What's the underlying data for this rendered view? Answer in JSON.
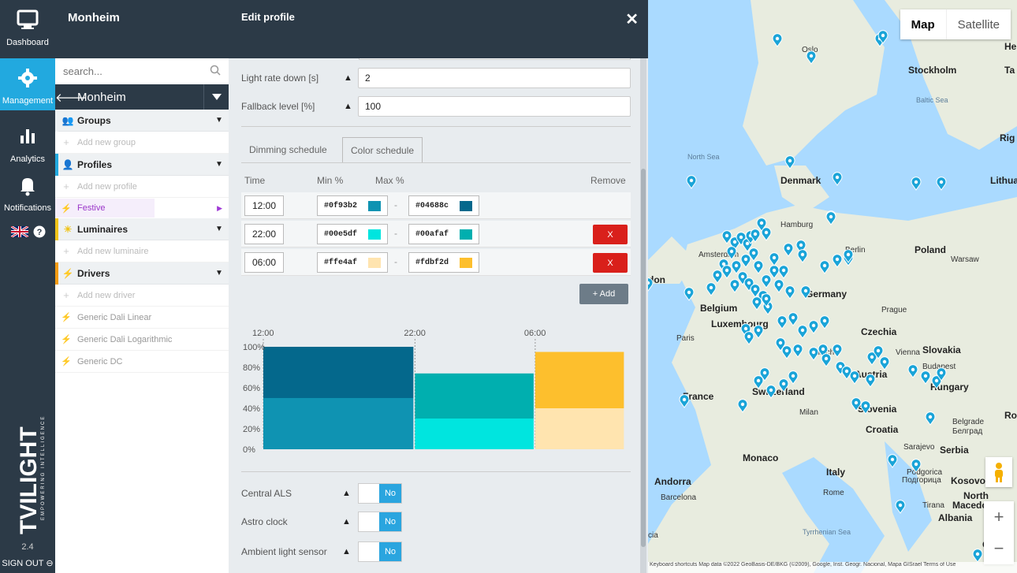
{
  "rail": {
    "dashboard": "Dashboard",
    "management": "Management",
    "analytics": "Analytics",
    "notifications": "Notifications",
    "brand_logo": "TVILIGHT",
    "brand_tag": "EMPOWERING INTELLIGENCE",
    "version": "2.4",
    "signout": "SIGN OUT"
  },
  "tree": {
    "title": "Monheim",
    "search_placeholder": "search...",
    "site": "Monheim",
    "groups": "Groups",
    "add_group": "Add new group",
    "profiles": "Profiles",
    "add_profile": "Add new profile",
    "festive": "Festive",
    "luminaires": "Luminaires",
    "add_luminaire": "Add new luminaire",
    "drivers": "Drivers",
    "add_driver": "Add new driver",
    "driver_items": [
      "Generic Dali Linear",
      "Generic Dali Logarithmic",
      "Generic DC"
    ]
  },
  "modal": {
    "title": "Edit profile",
    "light_rate_down_label": "Light rate down [s]",
    "light_rate_down_value": "2",
    "fallback_label": "Fallback level [%]",
    "fallback_value": "100",
    "tab_dimming": "Dimming schedule",
    "tab_color": "Color schedule",
    "col_time": "Time",
    "col_min": "Min %",
    "col_max": "Max %",
    "col_remove": "Remove",
    "rows": [
      {
        "time": "12:00",
        "min": "#0f93b2",
        "max": "#04688c",
        "removable": false
      },
      {
        "time": "22:00",
        "min": "#00e5df",
        "max": "#00afaf",
        "removable": true
      },
      {
        "time": "06:00",
        "min": "#ffe4af",
        "max": "#fdbf2d",
        "removable": true
      }
    ],
    "remove_label": "X",
    "add_label": "+ Add",
    "central_als": "Central ALS",
    "astro_clock": "Astro clock",
    "ambient_light": "Ambient light sensor",
    "no_label": "No"
  },
  "chart_data": {
    "type": "bar",
    "x_ticks": [
      "12:00",
      "22:00",
      "06:00"
    ],
    "y_ticks": [
      "100%",
      "80%",
      "60%",
      "40%",
      "20%",
      "0%"
    ],
    "ylim": [
      0,
      100
    ],
    "segments": [
      {
        "start": "12:00",
        "end": "22:00",
        "min": 50,
        "max": 100,
        "min_color": "#0f93b2",
        "max_color": "#04688c"
      },
      {
        "start": "22:00",
        "end": "06:00",
        "min": 30,
        "max": 74,
        "min_color": "#00e5df",
        "max_color": "#00afaf"
      },
      {
        "start": "06:00",
        "end": "12:00",
        "min": 40,
        "max": 95,
        "min_color": "#ffe4af",
        "max_color": "#fdbf2d"
      }
    ]
  },
  "map": {
    "map_btn": "Map",
    "satellite_btn": "Satellite",
    "labels": [
      "Oslo",
      "Stockholm",
      "Baltic Sea",
      "North Sea",
      "Denmark",
      "Lithua",
      "Hamburg",
      "Berlin",
      "Poland",
      "Warsaw",
      "Amsterdam",
      "Germany",
      "Belgium",
      "Prague",
      "Luxembourg",
      "Czechia",
      "Paris",
      "Slovakia",
      "Vienna",
      "Munich",
      "Budapest",
      "Austria",
      "Hungary",
      "France",
      "Switzerland",
      "Milan",
      "Slovenia",
      "Croatia",
      "Belgrade",
      "Белград",
      "Sarajevo",
      "Serbia",
      "Monaco",
      "Italy",
      "Podgorica",
      "Подгорица",
      "Kosovo",
      "Andorra",
      "Rome",
      "Barcelona",
      "North",
      "Macedonia",
      "Tirana",
      "Albania",
      "Tyrrhenian Sea",
      "Ro",
      "Rig",
      "He",
      "Ta",
      "Gr",
      "cia",
      "don"
    ],
    "attribution": "Keyboard shortcuts   Map data ©2022 GeoBasis-DE/BKG (©2009), Google, Inst. Geogr. Nacional, Mapa GISrael   Terms of Use"
  },
  "colors": {
    "navy": "#2c3a47",
    "accent": "#22a9df",
    "danger": "#d9201b",
    "profile_purple": "#9b37c9"
  }
}
